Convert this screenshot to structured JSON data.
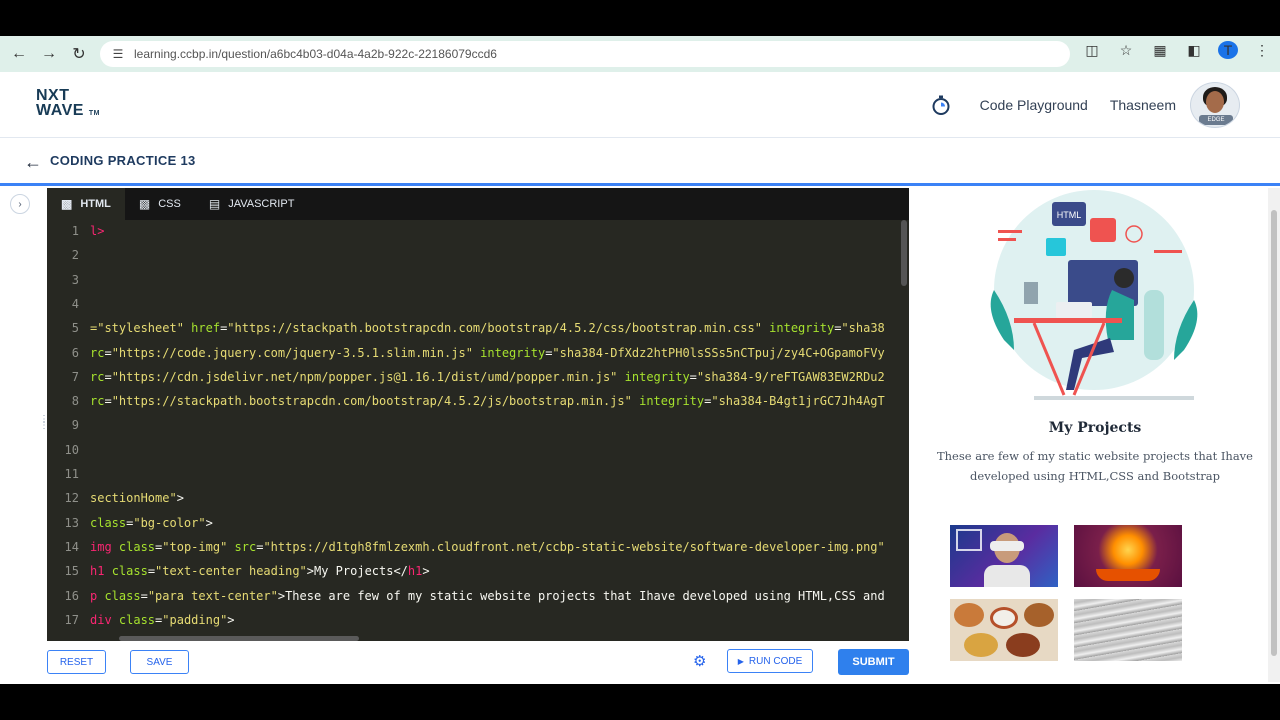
{
  "browser": {
    "url": "learning.ccbp.in/question/a6bc4b03-d04a-4a2b-922c-22186079ccd6",
    "profile_initial": "T"
  },
  "header": {
    "logo_line1": "NXT",
    "logo_line2": "WAVE",
    "logo_tm": "TM",
    "playground_label": "Code Playground",
    "username": "Thasneem",
    "avatar_badge": "EDGE"
  },
  "subheader": {
    "title": "CODING PRACTICE 13"
  },
  "editor": {
    "tabs": [
      {
        "label": "HTML",
        "active": true
      },
      {
        "label": "CSS",
        "active": false
      },
      {
        "label": "JAVASCRIPT",
        "active": false
      }
    ],
    "lines": [
      {
        "n": "1",
        "segments": [
          {
            "c": "t",
            "v": "l>"
          }
        ]
      },
      {
        "n": "2",
        "segments": []
      },
      {
        "n": "3",
        "segments": []
      },
      {
        "n": "4",
        "segments": []
      },
      {
        "n": "5",
        "segments": [
          {
            "c": "s",
            "v": "=\"stylesheet\" "
          },
          {
            "c": "a",
            "v": "href"
          },
          {
            "c": "",
            "v": "="
          },
          {
            "c": "s",
            "v": "\"https://stackpath.bootstrapcdn.com/bootstrap/4.5.2/css/bootstrap.min.css\" "
          },
          {
            "c": "a",
            "v": "integrity"
          },
          {
            "c": "",
            "v": "="
          },
          {
            "c": "s",
            "v": "\"sha38"
          }
        ]
      },
      {
        "n": "6",
        "segments": [
          {
            "c": "a",
            "v": "rc"
          },
          {
            "c": "",
            "v": "="
          },
          {
            "c": "s",
            "v": "\"https://code.jquery.com/jquery-3.5.1.slim.min.js\" "
          },
          {
            "c": "a",
            "v": "integrity"
          },
          {
            "c": "",
            "v": "="
          },
          {
            "c": "s",
            "v": "\"sha384-DfXdz2htPH0lsSSs5nCTpuj/zy4C+OGpamoFVy"
          }
        ]
      },
      {
        "n": "7",
        "segments": [
          {
            "c": "a",
            "v": "rc"
          },
          {
            "c": "",
            "v": "="
          },
          {
            "c": "s",
            "v": "\"https://cdn.jsdelivr.net/npm/popper.js@1.16.1/dist/umd/popper.min.js\" "
          },
          {
            "c": "a",
            "v": "integrity"
          },
          {
            "c": "",
            "v": "="
          },
          {
            "c": "s",
            "v": "\"sha384-9/reFTGAW83EW2RDu2"
          }
        ]
      },
      {
        "n": "8",
        "segments": [
          {
            "c": "a",
            "v": "rc"
          },
          {
            "c": "",
            "v": "="
          },
          {
            "c": "s",
            "v": "\"https://stackpath.bootstrapcdn.com/bootstrap/4.5.2/js/bootstrap.min.js\" "
          },
          {
            "c": "a",
            "v": "integrity"
          },
          {
            "c": "",
            "v": "="
          },
          {
            "c": "s",
            "v": "\"sha384-B4gt1jrGC7Jh4AgT"
          }
        ]
      },
      {
        "n": "9",
        "segments": []
      },
      {
        "n": "10",
        "segments": []
      },
      {
        "n": "11",
        "segments": []
      },
      {
        "n": "12",
        "segments": [
          {
            "c": "s",
            "v": "sectionHome\""
          },
          {
            "c": "",
            "v": ">"
          }
        ]
      },
      {
        "n": "13",
        "segments": [
          {
            "c": "a",
            "v": "class"
          },
          {
            "c": "",
            "v": "="
          },
          {
            "c": "s",
            "v": "\"bg-color\""
          },
          {
            "c": "",
            "v": ">"
          }
        ]
      },
      {
        "n": "14",
        "segments": [
          {
            "c": "t",
            "v": "img "
          },
          {
            "c": "a",
            "v": "class"
          },
          {
            "c": "",
            "v": "="
          },
          {
            "c": "s",
            "v": "\"top-img\" "
          },
          {
            "c": "a",
            "v": "src"
          },
          {
            "c": "",
            "v": "="
          },
          {
            "c": "s",
            "v": "\"https://d1tgh8fmlzexmh.cloudfront.net/ccbp-static-website/software-developer-img.png\""
          }
        ]
      },
      {
        "n": "15",
        "segments": [
          {
            "c": "t",
            "v": "h1 "
          },
          {
            "c": "a",
            "v": "class"
          },
          {
            "c": "",
            "v": "="
          },
          {
            "c": "s",
            "v": "\"text-center heading\""
          },
          {
            "c": "",
            "v": ">My Projects</"
          },
          {
            "c": "t",
            "v": "h1"
          },
          {
            "c": "",
            "v": ">"
          }
        ]
      },
      {
        "n": "16",
        "segments": [
          {
            "c": "t",
            "v": "p "
          },
          {
            "c": "a",
            "v": "class"
          },
          {
            "c": "",
            "v": "="
          },
          {
            "c": "s",
            "v": "\"para text-center\""
          },
          {
            "c": "",
            "v": ">These are few of my static website projects that Ihave developed using HTML,CSS and"
          }
        ]
      },
      {
        "n": "17",
        "segments": [
          {
            "c": "t",
            "v": "div "
          },
          {
            "c": "a",
            "v": "class"
          },
          {
            "c": "",
            "v": "="
          },
          {
            "c": "s",
            "v": "\"padding\""
          },
          {
            "c": "",
            "v": ">"
          }
        ]
      }
    ]
  },
  "buttons": {
    "reset": "RESET",
    "save": "SAVE",
    "run": "RUN CODE",
    "submit": "SUBMIT"
  },
  "preview": {
    "title": "My Projects",
    "paragraph": "These are few of my static website projects that Ihave developed using HTML,CSS and Bootstrap",
    "illustration_html_label": "HTML"
  },
  "colors": {
    "accent": "#2f80ed",
    "editor_bg": "#272822",
    "browser_bar": "#dff0ea"
  }
}
